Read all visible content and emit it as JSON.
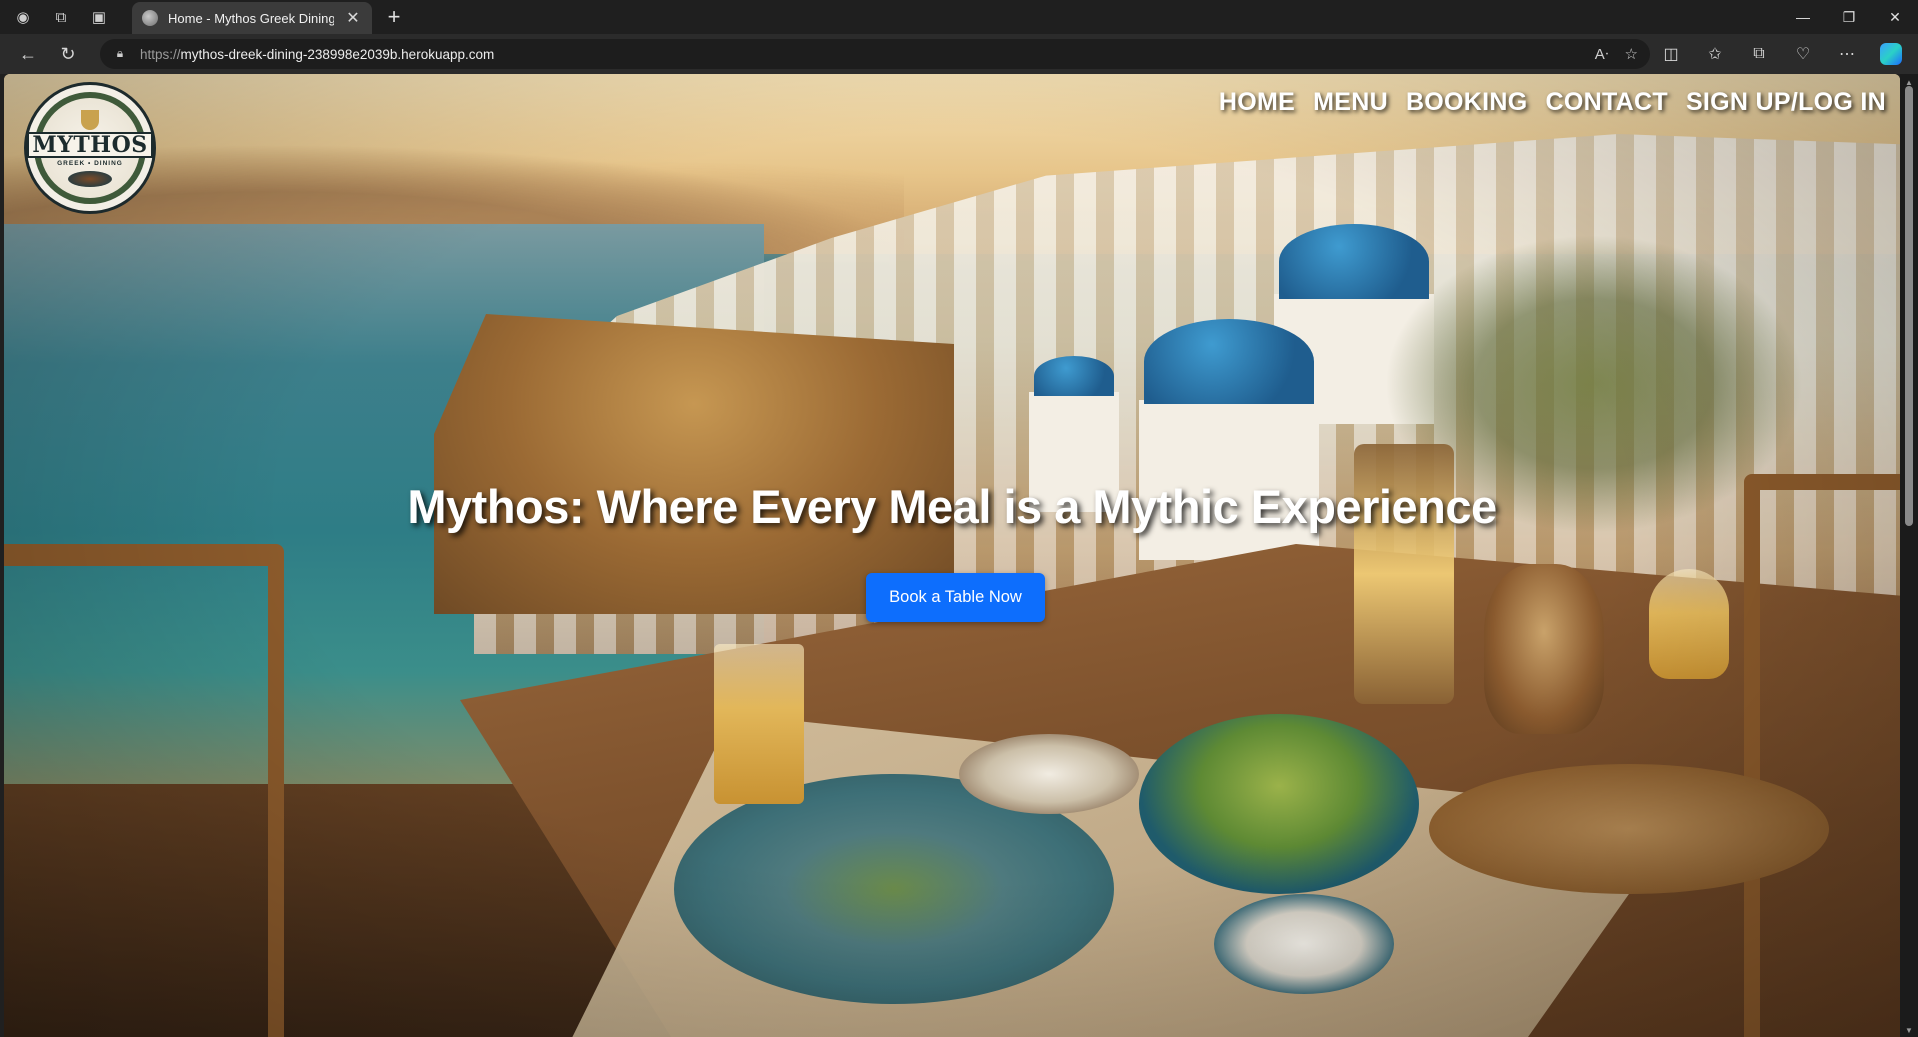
{
  "browser": {
    "tab": {
      "title": "Home - Mythos Greek Dining",
      "close_glyph": "✕"
    },
    "new_tab_glyph": "+",
    "address": {
      "scheme": "https://",
      "host": "mythos-dreek-dining-238998e2039b.herokuapp.com"
    },
    "window_controls": {
      "minimize": "—",
      "restore": "❐",
      "close": "✕"
    }
  },
  "site": {
    "logo": {
      "word": "MYTHOS",
      "sub": "GREEK • DINING"
    },
    "nav": [
      {
        "label": "HOME"
      },
      {
        "label": "MENU"
      },
      {
        "label": "BOOKING"
      },
      {
        "label": "CONTACT"
      },
      {
        "label": "SIGN UP/LOG IN"
      }
    ],
    "hero": {
      "title": "Mythos: Where Every Meal is a Mythic Experience",
      "cta_label": "Book a Table Now"
    }
  },
  "colors": {
    "cta": "#0d6efd",
    "chrome_dark": "#1f1f1f",
    "address_bar": "#1d1d1d"
  },
  "icons": {
    "titlebar": [
      "profile-icon",
      "workspaces-icon",
      "vertical-tabs-icon"
    ],
    "navbar": [
      "back-icon",
      "refresh-icon",
      "lock-icon"
    ],
    "address_right": [
      "read-aloud-icon",
      "favorite-star-icon"
    ],
    "toolbar": [
      "split-screen-icon",
      "favorites-icon",
      "collections-icon",
      "browser-essentials-icon",
      "more-icon",
      "copilot-icon"
    ]
  }
}
